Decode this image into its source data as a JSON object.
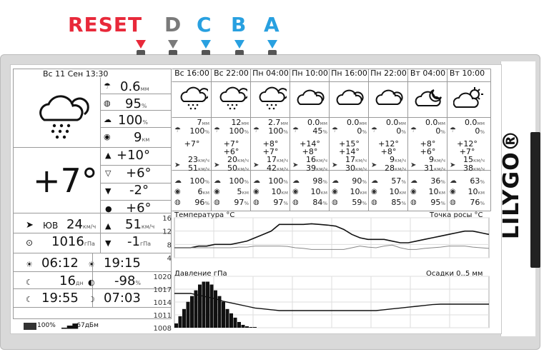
{
  "buttons": [
    {
      "label": "RESET",
      "color": "#e8293a"
    },
    {
      "label": "D",
      "color": "#7a7a7a"
    },
    {
      "label": "C",
      "color": "#28a0e0"
    },
    {
      "label": "B",
      "color": "#28a0e0"
    },
    {
      "label": "A",
      "color": "#28a0e0"
    }
  ],
  "brand": "LILYGO®",
  "now": {
    "datetime": "Вс 11 Сен 13:30",
    "rain": "0.6",
    "rain_unit": "мм",
    "humidity": "95",
    "humidity_unit": "%",
    "cloud": "100",
    "cloud_unit": "%",
    "visibility": "9",
    "visibility_unit": "км",
    "temp": "+7°",
    "tmax": "+10°",
    "tmin": "+6°",
    "dmin": "-2°",
    "dew": "+6°",
    "wind_dir": "ЮВ",
    "wind_speed": "24",
    "wind_unit": "км/ч",
    "gust": "51",
    "gust_unit": "км/ч",
    "pressure": "1016",
    "pressure_unit": "гПа",
    "ptrend": "-1",
    "ptrend_unit": "гПа"
  },
  "sun": {
    "sunrise": "06:12",
    "sunset": "19:15",
    "moon_age": "16",
    "moon_age_unit": "дн",
    "elev": "-98",
    "elev_unit": "%",
    "moonrise": "19:55",
    "moonset": "07:03"
  },
  "status": {
    "battery": "100",
    "battery_unit": "%",
    "rssi": "-67",
    "rssi_unit": "дБм"
  },
  "forecast": [
    {
      "time": "Вс 16:00",
      "icon": "rain-cloud-icon",
      "rain": "7",
      "rain_u": "мм",
      "prob": "100",
      "t1": "+7°",
      "t2": "",
      "wind": "23",
      "gust": "51",
      "hum": "100",
      "vis": "6",
      "vis_u": "км",
      "cloud": "96"
    },
    {
      "time": "Вс 22:00",
      "icon": "rain-cloud-icon",
      "rain": "12",
      "rain_u": "мм",
      "prob": "100",
      "t1": "+7°",
      "t2": "+6°",
      "wind": "20",
      "gust": "50",
      "hum": "100",
      "vis": "5",
      "vis_u": "км",
      "cloud": "97"
    },
    {
      "time": "Пн 04:00",
      "icon": "rain-cloud-icon",
      "rain": "2.7",
      "rain_u": "мм",
      "prob": "100",
      "t1": "+8°",
      "t2": "+7°",
      "wind": "17",
      "gust": "42",
      "hum": "100",
      "vis": "10",
      "vis_u": "км",
      "cloud": "97"
    },
    {
      "time": "Пн 10:00",
      "icon": "cloud-icon",
      "rain": "0.0",
      "rain_u": "мм",
      "prob": "45",
      "t1": "+14°",
      "t2": "+8°",
      "wind": "16",
      "gust": "39",
      "hum": "98",
      "vis": "10",
      "vis_u": "км",
      "cloud": "84"
    },
    {
      "time": "Пн 16:00",
      "icon": "cloud-icon",
      "rain": "0.0",
      "rain_u": "мм",
      "prob": "0",
      "t1": "+15°",
      "t2": "+14°",
      "wind": "17",
      "gust": "30",
      "hum": "90",
      "vis": "10",
      "vis_u": "км",
      "cloud": "59"
    },
    {
      "time": "Пн 22:00",
      "icon": "cloud-icon",
      "rain": "0.0",
      "rain_u": "мм",
      "prob": "0",
      "t1": "+12°",
      "t2": "+8°",
      "wind": "9",
      "gust": "28",
      "hum": "57",
      "vis": "10",
      "vis_u": "км",
      "cloud": "85"
    },
    {
      "time": "Вт 04:00",
      "icon": "cloud-moon-icon",
      "rain": "0.0",
      "rain_u": "мм",
      "prob": "0",
      "t1": "+8°",
      "t2": "+6°",
      "wind": "9",
      "gust": "31",
      "hum": "36",
      "vis": "10",
      "vis_u": "км",
      "cloud": "95"
    },
    {
      "time": "Вт 10:00",
      "icon": "cloud-sun-icon",
      "rain": "0.0",
      "rain_u": "мм",
      "prob": "0",
      "t1": "+12°",
      "t2": "+7°",
      "wind": "15",
      "gust": "38",
      "hum": "63",
      "vis": "10",
      "vis_u": "км",
      "cloud": "76"
    }
  ],
  "wind_unit_small": "км/ч",
  "chart_data": [
    {
      "type": "line",
      "title": "Температура °C",
      "title_right": "Точка росы °C",
      "ylim": [
        4,
        16
      ],
      "yticks": [
        "16",
        "12",
        "8",
        "4"
      ],
      "series": [
        {
          "name": "Температура °C",
          "values": [
            7,
            7,
            7,
            7.5,
            7.5,
            8,
            8,
            8,
            8.5,
            9,
            10,
            11,
            12,
            14,
            14,
            14,
            14,
            14.2,
            14,
            13.8,
            13.5,
            12.5,
            11,
            10,
            9.5,
            9.5,
            9.5,
            9,
            8.5,
            8.5,
            9,
            9.5,
            10,
            10.5,
            11,
            11.5,
            12,
            12,
            11.5,
            11
          ]
        },
        {
          "name": "Точка росы °C",
          "values": [
            7,
            7,
            7,
            7,
            7,
            7,
            7,
            7,
            7.2,
            7.2,
            7.5,
            7.5,
            7.5,
            7.5,
            7.4,
            7,
            6.8,
            6.5,
            6.5,
            6.5,
            6.5,
            6.5,
            7,
            7.5,
            7.2,
            7,
            7.5,
            7.8,
            7,
            6.5,
            6.5,
            6.8,
            7,
            7.2,
            7.5,
            7.5,
            7.5,
            7.2,
            7,
            6.8
          ]
        }
      ]
    },
    {
      "type": "bar",
      "title": "Давление гПа",
      "title_right": "Осадки 0..5 мм",
      "ylim": [
        1008,
        1020
      ],
      "yticks": [
        "1020",
        "1017",
        "1014",
        "1011",
        "1008"
      ],
      "bars": [
        0.3,
        0.8,
        1.3,
        1.8,
        2.2,
        2.6,
        3.0,
        3.2,
        3.2,
        3.0,
        2.6,
        2.2,
        1.8,
        1.3,
        1.0,
        0.7,
        0.4,
        0.2,
        0.1,
        0.05,
        0.05
      ],
      "pressure": [
        1016,
        1016,
        1016,
        1015.6,
        1015.2,
        1014.8,
        1014.2,
        1013.8,
        1013.4,
        1013.0,
        1012.6,
        1012.4,
        1012.2,
        1012.0,
        1012.0,
        1012.0,
        1012.0,
        1012.0,
        1012.0,
        1012.0,
        1012.0,
        1012.0,
        1012.0,
        1012.0,
        1012.0,
        1012.0,
        1012.2,
        1012.4,
        1012.6,
        1012.8,
        1013,
        1013.2,
        1013.4,
        1013.5,
        1013.5,
        1013.5,
        1013.5,
        1013.5,
        1013.5,
        1013.5
      ]
    }
  ]
}
